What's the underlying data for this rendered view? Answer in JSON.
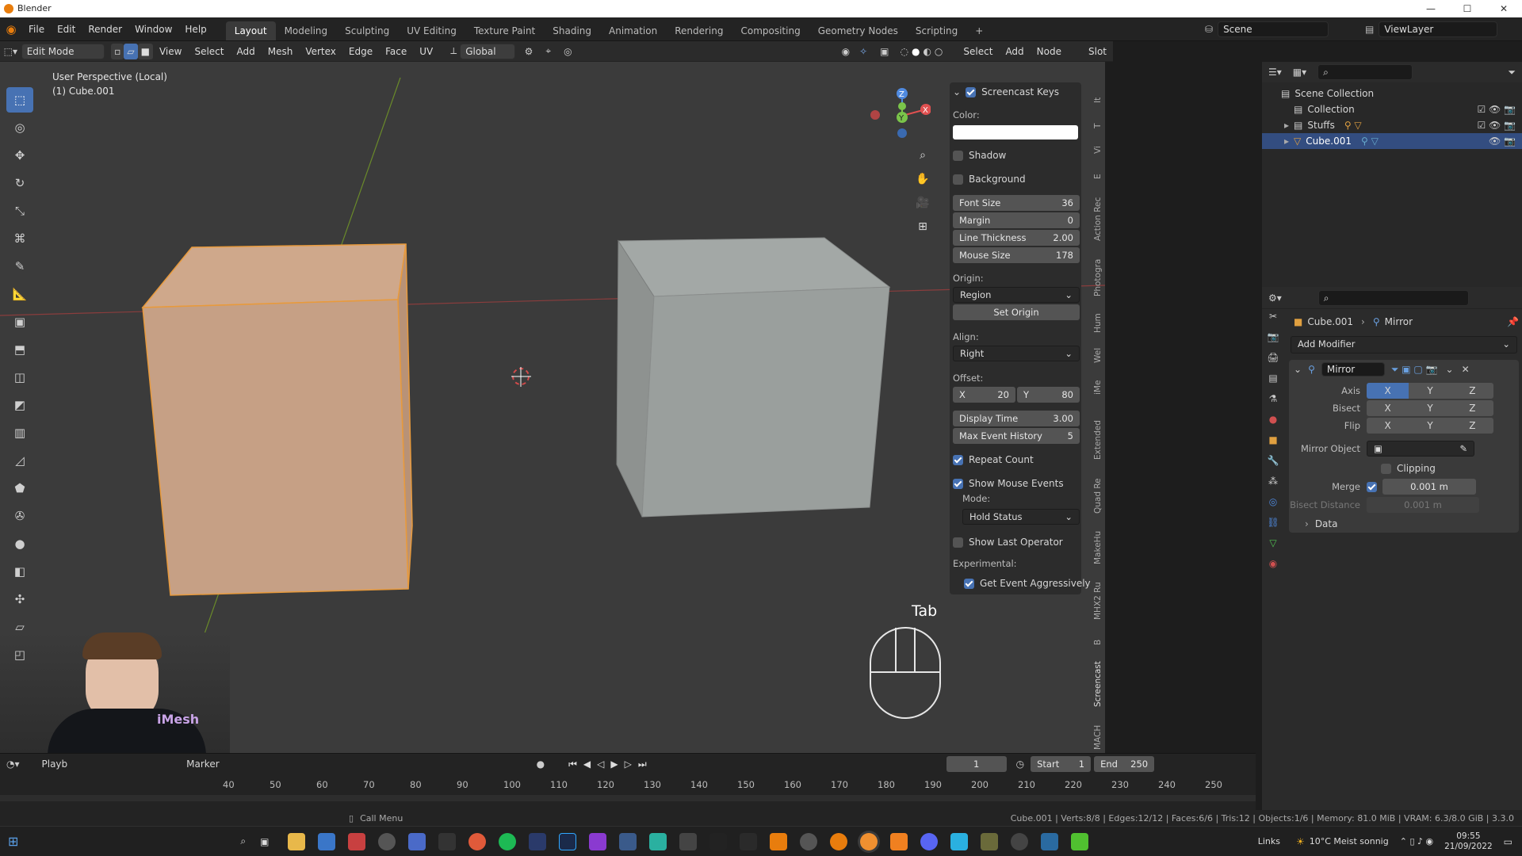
{
  "app": {
    "title": "Blender"
  },
  "menu": [
    "File",
    "Edit",
    "Render",
    "Window",
    "Help"
  ],
  "workspaces": [
    "Layout",
    "Modeling",
    "Sculpting",
    "UV Editing",
    "Texture Paint",
    "Shading",
    "Animation",
    "Rendering",
    "Compositing",
    "Geometry Nodes",
    "Scripting"
  ],
  "scene": {
    "scene_label": "Scene",
    "viewlayer_label": "ViewLayer"
  },
  "viewport_header": {
    "mode": "Edit Mode",
    "menus": [
      "View",
      "Select",
      "Add",
      "Mesh",
      "Vertex",
      "Edge",
      "Face",
      "UV"
    ],
    "transform": "Global",
    "right_menus": [
      "Select",
      "Add",
      "Node",
      "Slot"
    ],
    "options": "Options"
  },
  "viewport": {
    "view_label": "User Perspective (Local)",
    "object_label": "(1) Cube.001",
    "key_display": "Tab"
  },
  "screencast": {
    "title": "Screencast Keys",
    "color_label": "Color:",
    "shadow": "Shadow",
    "background": "Background",
    "font_size": {
      "label": "Font Size",
      "value": "36"
    },
    "margin": {
      "label": "Margin",
      "value": "0"
    },
    "line_thickness": {
      "label": "Line Thickness",
      "value": "2.00"
    },
    "mouse_size": {
      "label": "Mouse Size",
      "value": "178"
    },
    "origin_label": "Origin:",
    "origin_value": "Region",
    "set_origin": "Set Origin",
    "align_label": "Align:",
    "align_value": "Right",
    "offset_label": "Offset:",
    "offset_x_label": "X",
    "offset_x": "20",
    "offset_y_label": "Y",
    "offset_y": "80",
    "display_time": {
      "label": "Display Time",
      "value": "3.00"
    },
    "max_event": {
      "label": "Max Event History",
      "value": "5"
    },
    "repeat_count": "Repeat Count",
    "show_mouse": "Show Mouse Events",
    "mode_label": "Mode:",
    "mode_value": "Hold Status",
    "show_last": "Show Last Operator",
    "experimental": "Experimental:",
    "get_event": "Get Event Aggressively"
  },
  "side_tabs": [
    "Action Rec",
    "Photogra",
    "Hum",
    "Wel",
    "iMe",
    "Extended",
    "Quad Re",
    "MakeHu",
    "MHX2 Ru",
    "B",
    "Screencast",
    "MACH"
  ],
  "outliner": {
    "root": "Scene Collection",
    "items": [
      "Collection",
      "Stuffs",
      "Cube.001"
    ]
  },
  "properties": {
    "object": "Cube.001",
    "modifier_crumb": "Mirror",
    "add_modifier": "Add Modifier",
    "modifier_name": "Mirror",
    "axis_label": "Axis",
    "bisect_label": "Bisect",
    "flip_label": "Flip",
    "x": "X",
    "y": "Y",
    "z": "Z",
    "mirror_object": "Mirror Object",
    "clipping": "Clipping",
    "merge_label": "Merge",
    "merge_value": "0.001 m",
    "bisect_distance": "Bisect Distance",
    "bisect_value": "0.001 m",
    "data": "Data"
  },
  "timeline": {
    "playback": "Playb",
    "marker": "Marker",
    "frame": "1",
    "start_label": "Start",
    "start": "1",
    "end_label": "End",
    "end": "250",
    "ticks": [
      "40",
      "50",
      "60",
      "70",
      "80",
      "90",
      "100",
      "110",
      "120",
      "130",
      "140",
      "150",
      "160",
      "170",
      "180",
      "190",
      "200",
      "210",
      "220",
      "230",
      "240",
      "250"
    ]
  },
  "status": {
    "call_menu": "Call Menu",
    "stats": "Cube.001 | Verts:8/8 | Edges:12/12 | Faces:6/6 | Tris:12 | Objects:1/6 | Memory: 81.0 MiB | VRAM: 6.3/8.0 GiB | 3.3.0"
  },
  "taskbar": {
    "weather_links": "Links",
    "weather": "10°C  Meist sonnig",
    "time": "09:55",
    "date": "21/09/2022",
    "webcam_brand": "iMesh"
  }
}
